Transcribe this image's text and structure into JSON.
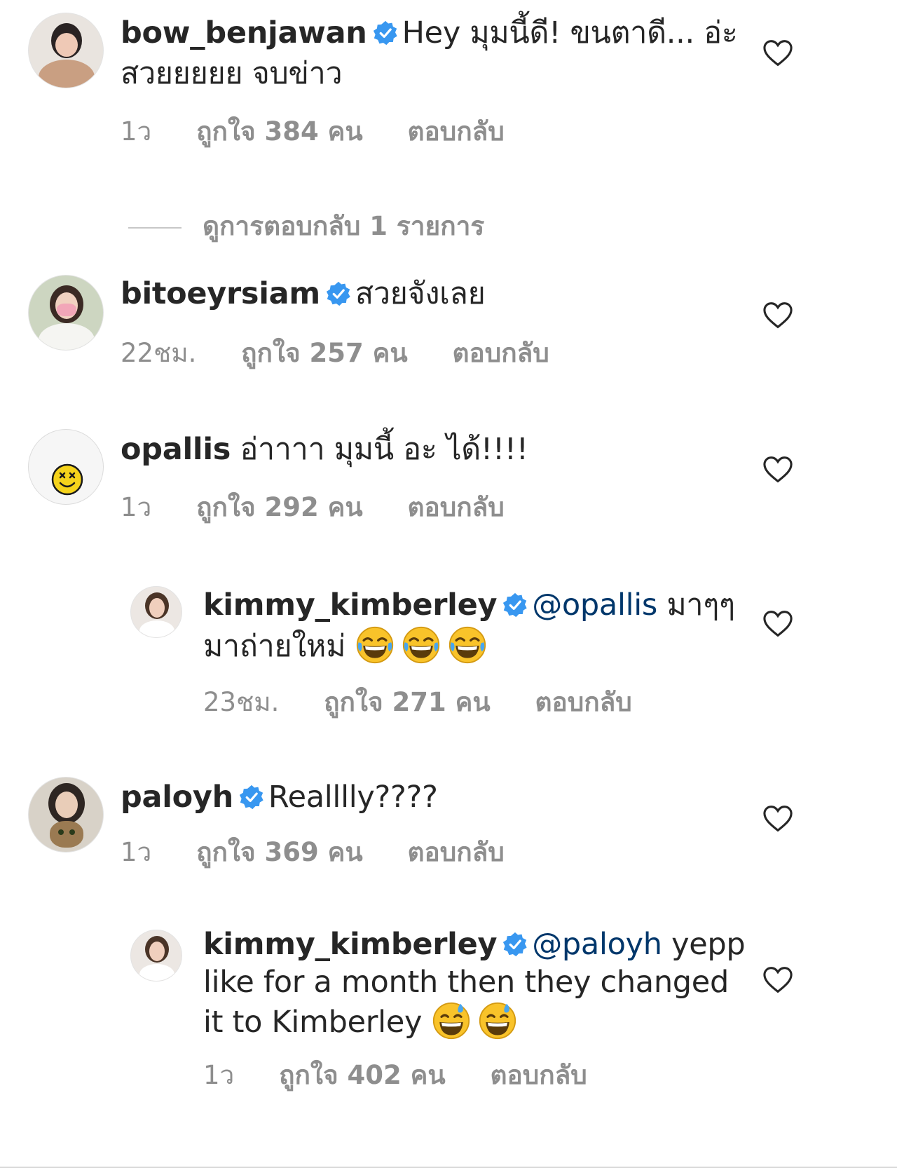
{
  "colors": {
    "verified": "#3897f0",
    "text": "#262626",
    "muted": "#8e8e8e",
    "mention": "#00376b"
  },
  "comments": [
    {
      "username": "bow_benjawan",
      "verified": true,
      "lines": [
        "Hey  มุมนี้ดี! ขนตาดี... อ่ะ",
        "สวยยยยย จบข่าว"
      ],
      "time": "1ว",
      "likes": "ถูกใจ 384 คน",
      "reply": "ตอบกลับ",
      "view_replies": "ดูการตอบกลับ 1 รายการ"
    },
    {
      "username": "bitoeyrsiam",
      "verified": true,
      "text": "สวยจังเลย",
      "time": "22ชม.",
      "likes": "ถูกใจ 257 คน",
      "reply": "ตอบกลับ"
    },
    {
      "username": "opallis",
      "verified": false,
      "text": "อ่าาาา มุมนี้ อะ ได้!!!!",
      "time": "1ว",
      "likes": "ถูกใจ 292 คน",
      "reply": "ตอบกลับ"
    },
    {
      "username": "kimmy_kimberley",
      "verified": true,
      "mention": "@opallis",
      "text_tail": "มาๆๆ",
      "line2": "มาถ่ายใหม่",
      "emoji": "face-with-tears-of-joy-emoji",
      "time": "23ชม.",
      "likes": "ถูกใจ 271 คน",
      "reply": "ตอบกลับ"
    },
    {
      "username": "paloyh",
      "verified": true,
      "text": "Realllly????",
      "time": "1ว",
      "likes": "ถูกใจ 369 คน",
      "reply": "ตอบกลับ"
    },
    {
      "username": "kimmy_kimberley",
      "verified": true,
      "mention": "@paloyh",
      "text_tail": "yepp",
      "line2": "like for a month then they changed",
      "line3": "it to Kimberley",
      "emoji": "grinning-face-with-sweat-emoji",
      "time": "1ว",
      "likes": "ถูกใจ 402 คน",
      "reply": "ตอบกลับ"
    }
  ]
}
